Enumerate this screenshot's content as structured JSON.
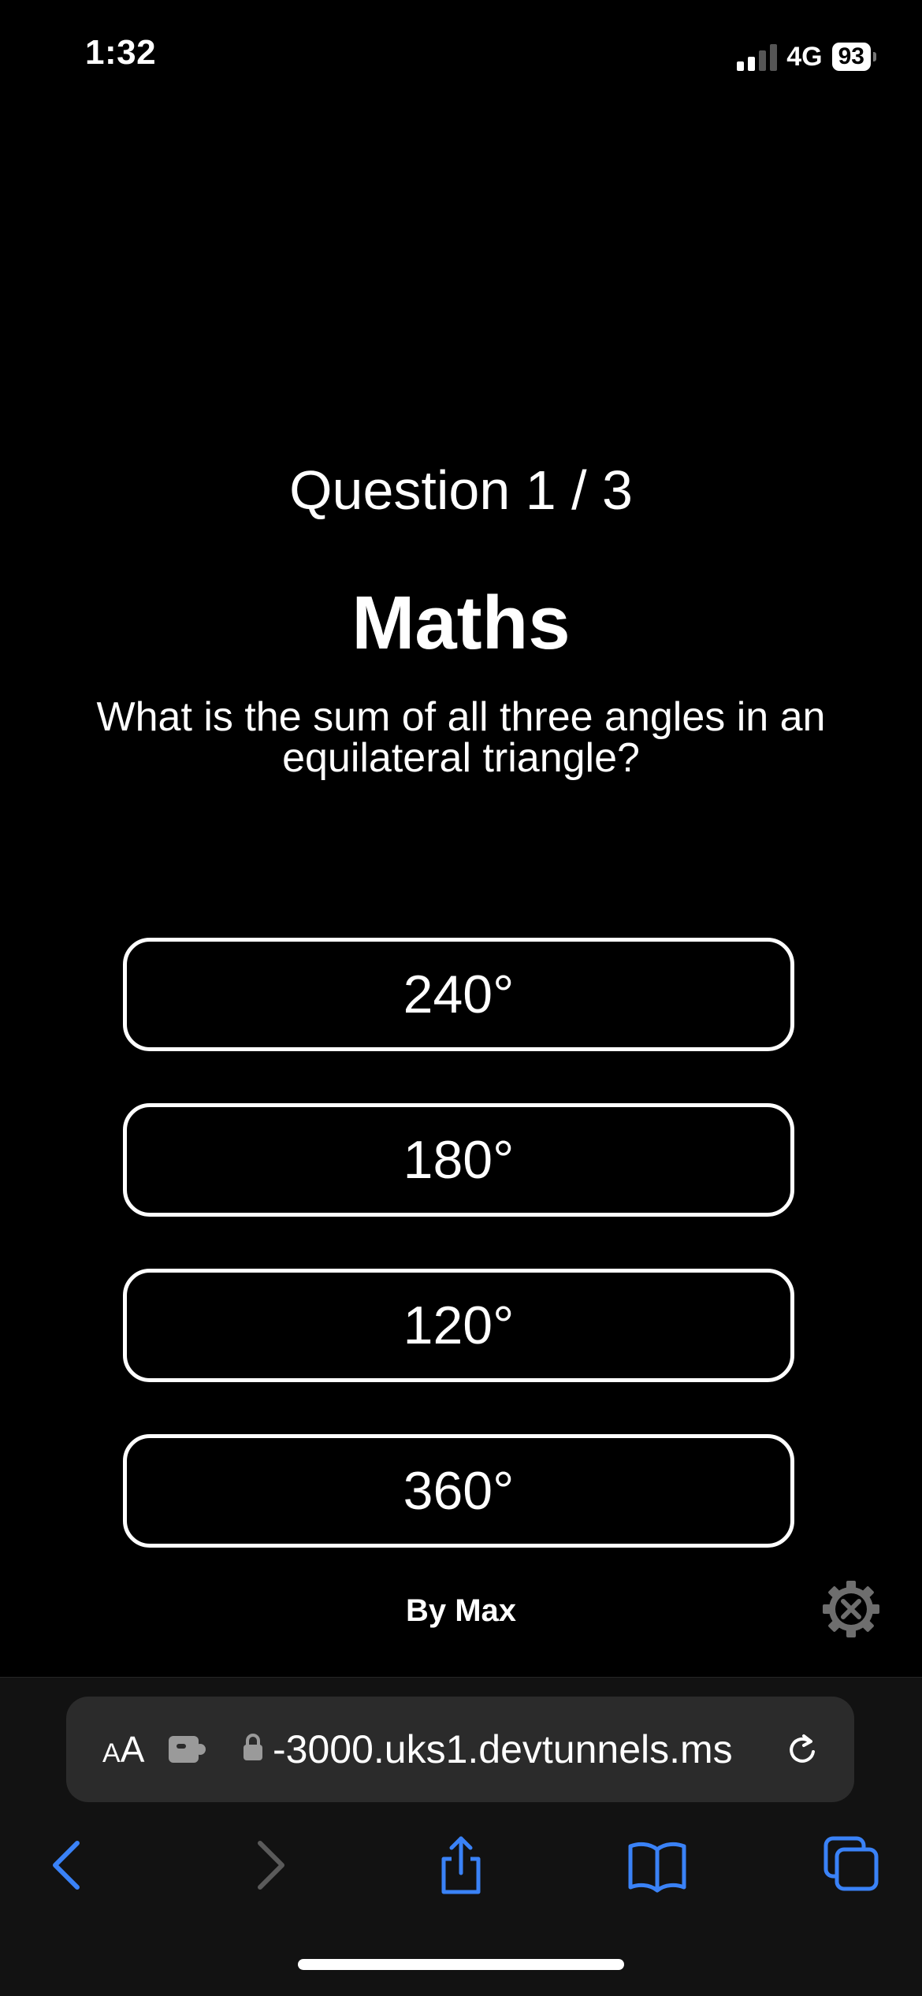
{
  "status_bar": {
    "time": "1:32",
    "network": "4G",
    "battery": "93"
  },
  "quiz": {
    "counter": "Question 1 / 3",
    "subject": "Maths",
    "question": "What is the sum of all three angles in an equilateral triangle?",
    "answers": [
      "240°",
      "180°",
      "120°",
      "360°"
    ],
    "author": "By Max"
  },
  "browser": {
    "text_size_label_small": "A",
    "text_size_label_large": "A",
    "url": "-3000.uks1.devtunnels.ms"
  },
  "colors": {
    "background": "#000000",
    "toolbar_accent": "#3a82f7",
    "toolbar_disabled": "#5a5a5a"
  },
  "icons": {
    "settings": "gear-tools-icon",
    "extension": "puzzle-icon",
    "lock": "lock-icon",
    "reload": "reload-icon",
    "back": "chevron-left-icon",
    "forward": "chevron-right-icon",
    "share": "share-icon",
    "bookmarks": "book-icon",
    "tabs": "tabs-icon"
  }
}
